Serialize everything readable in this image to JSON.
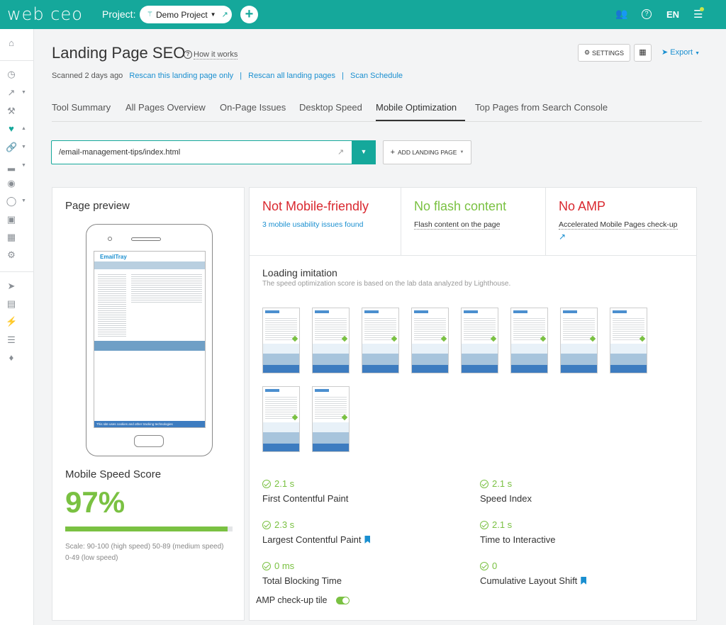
{
  "topbar": {
    "logo": "web ceo",
    "project_label": "Project:",
    "project_name": "Demo Project",
    "plus": "+",
    "lang": "EN"
  },
  "header": {
    "title": "Landing Page SEO",
    "help_glyph": "?",
    "how_it_works": "How it works",
    "settings_label": "SETTINGS",
    "export_label": "Export",
    "scanned_text": "Scanned 2 days ago",
    "rescan_page": "Rescan this landing page only",
    "rescan_all": "Rescan all landing pages",
    "scan_schedule": "Scan Schedule",
    "separator": "|"
  },
  "tabs": [
    {
      "label": "Tool Summary"
    },
    {
      "label": "All Pages Overview"
    },
    {
      "label": "On-Page Issues"
    },
    {
      "label": "Desktop Speed"
    },
    {
      "label": "Mobile Optimization"
    },
    {
      "label": "Top Pages from Search Console"
    }
  ],
  "active_tab": "Mobile Optimization",
  "url_select": {
    "value": "/email-management-tips/index.html",
    "add_label": "ADD LANDING PAGE"
  },
  "page_preview": {
    "title": "Page preview",
    "screen_logo": "EmailTray",
    "screen_banner": "This site uses cookies and other tracking technologies"
  },
  "mobile_speed": {
    "title": "Mobile Speed Score",
    "value": "97%",
    "score_fraction": 0.97,
    "scale": "Scale: 90-100 (high speed) 50-89 (medium speed) 0-49 (low speed)"
  },
  "status_cells": [
    {
      "title": "Not Mobile-friendly",
      "sub": "3 mobile usability issues found",
      "color": "#d9282f"
    },
    {
      "title": "No flash content",
      "sub": "Flash content on the page",
      "color": "#7ac142"
    },
    {
      "title": "No AMP",
      "sub": "Accelerated Mobile Pages check-up",
      "color": "#d9282f"
    }
  ],
  "loading": {
    "title": "Loading imitation",
    "subtitle": "The speed optimization score is based on the lab data analyzed by Lighthouse.",
    "frame_count": 10
  },
  "metrics": [
    {
      "value": "2.1 s",
      "name": "First Contentful Paint",
      "bookmark": false
    },
    {
      "value": "2.1 s",
      "name": "Speed Index",
      "bookmark": false
    },
    {
      "value": "2.3 s",
      "name": "Largest Contentful Paint",
      "bookmark": true
    },
    {
      "value": "2.1 s",
      "name": "Time to Interactive",
      "bookmark": false
    },
    {
      "value": "0 ms",
      "name": "Total Blocking Time",
      "bookmark": false
    },
    {
      "value": "0",
      "name": "Cumulative Layout Shift",
      "bookmark": true
    }
  ],
  "amp_tile": {
    "label": "AMP check-up tile",
    "enabled": true
  },
  "colors": {
    "accent": "#15a89b",
    "link": "#1a8fd0",
    "good": "#7ac142",
    "bad": "#d9282f"
  }
}
